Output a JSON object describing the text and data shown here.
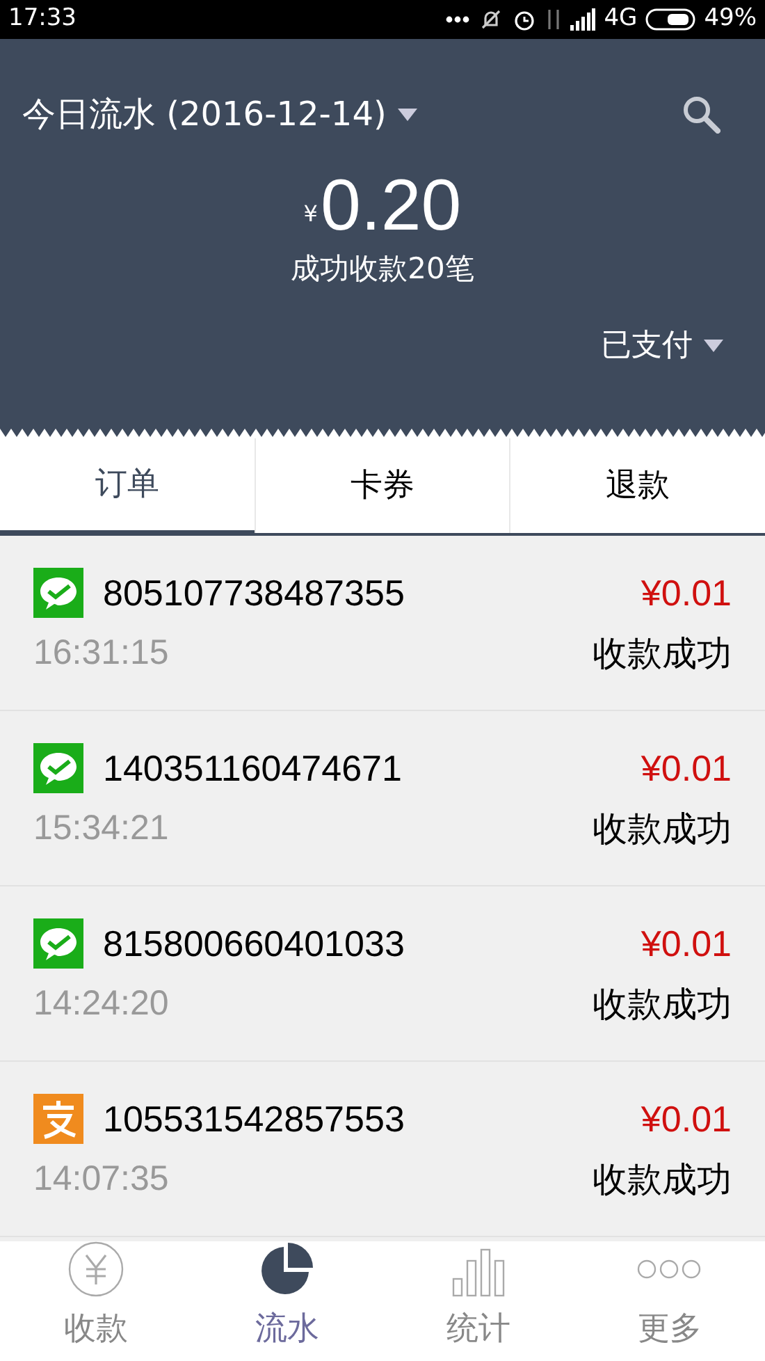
{
  "status_bar": {
    "time": "17:33",
    "network": "4G",
    "battery": "49%"
  },
  "header": {
    "title": "今日流水 (2016-12-14)",
    "currency": "¥",
    "amount": "0.20",
    "summary": "成功收款20笔",
    "filter": "已支付"
  },
  "tabs": [
    {
      "label": "订单",
      "selected": true
    },
    {
      "label": "卡券",
      "selected": false
    },
    {
      "label": "退款",
      "selected": false
    }
  ],
  "orders": [
    {
      "kind": "wechat",
      "order_no": "805107738487355",
      "time": "16:31:15",
      "amount": "¥0.01",
      "status": "收款成功"
    },
    {
      "kind": "wechat",
      "order_no": "140351160474671",
      "time": "15:34:21",
      "amount": "¥0.01",
      "status": "收款成功"
    },
    {
      "kind": "wechat",
      "order_no": "815800660401033",
      "time": "14:24:20",
      "amount": "¥0.01",
      "status": "收款成功"
    },
    {
      "kind": "alipay",
      "order_no": "105531542857553",
      "time": "14:07:35",
      "amount": "¥0.01",
      "status": "收款成功"
    }
  ],
  "bottom_nav": [
    {
      "kind": "yen",
      "label": "收款",
      "selected": false
    },
    {
      "kind": "pie",
      "label": "流水",
      "selected": true
    },
    {
      "kind": "bars",
      "label": "统计",
      "selected": false
    },
    {
      "kind": "more",
      "label": "更多",
      "selected": false
    }
  ]
}
